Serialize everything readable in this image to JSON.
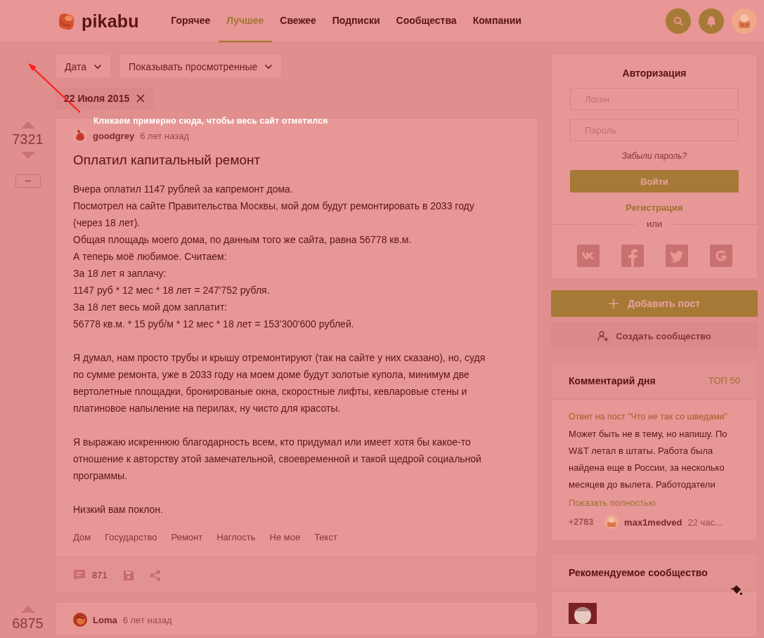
{
  "header": {
    "logo": "pikabu",
    "nav": [
      {
        "label": "Горячее",
        "selected": false
      },
      {
        "label": "Лучшее",
        "selected": true
      },
      {
        "label": "Свежее",
        "selected": false
      },
      {
        "label": "Подписки",
        "selected": false
      },
      {
        "label": "Сообщества",
        "selected": false
      },
      {
        "label": "Компании",
        "selected": false
      }
    ]
  },
  "filters": [
    {
      "label": "Дата"
    },
    {
      "label": "Показывать просмотренные"
    }
  ],
  "date_chip": "22 Июля 2015",
  "annotation": "Кликаем примерно сюда, чтобы весь сайт отметился",
  "posts": [
    {
      "rating": "7321",
      "author": "goodgrey",
      "time": "6 лет назад",
      "title": "Оплатил капитальный ремонт",
      "blocks": [
        [
          "Вчера оплатил 1147 рублей за капремонт дома.",
          "Посмотрел на сайте Правительства Москвы, мой дом будут ремонтировать в 2033 году (через 18 лет).",
          "Общая площадь моего дома, по данным того же сайта, равна 56778 кв.м.",
          "А теперь моё любимое. Считаем:",
          "За 18 лет я заплачу:",
          "1147 руб * 12 мес * 18 лет = 247'752 рубля.",
          "За 18 лет весь мой дом заплатит:",
          "56778 кв.м. * 15 руб/м * 12 мес * 18 лет = 153'300'600 рублей."
        ],
        [
          "Я думал, нам просто трубы и крышу отремонтируют (так на сайте у них сказано), но, судя по сумме ремонта, уже в 2033 году на моем доме будут золотые купола, минимум две вертолетные площадки, бронированые окна, скоростные лифты, кевларовые стены и платиновое напыление на перилах, ну чисто для красоты."
        ],
        [
          "Я выражаю искреннюю благодарность всем, кто придумал или имеет хотя бы какое-то отношение к авторству этой замечательной, своевременной и такой щедрой социальной программы."
        ],
        [
          "Низкий вам поклон."
        ]
      ],
      "tags": [
        "Дом",
        "Государство",
        "Ремонт",
        "Наглость",
        "Не мое",
        "Текст"
      ],
      "comments": "871"
    },
    {
      "rating": "6875",
      "author": "Loma",
      "time": "6 лет назад"
    }
  ],
  "auth": {
    "title": "Авторизация",
    "login_placeholder": "Логин",
    "password_placeholder": "Пароль",
    "forgot": "Забыли пароль?",
    "submit": "Войти",
    "register": "Регистрация",
    "or": "или"
  },
  "add_post": "Добавить пост",
  "create_community": "Создать сообщество",
  "comment_of_day": {
    "title": "Комментарий дня",
    "top": "ТОП 50",
    "post_link": "Ответ на пост \"Что не так со шведами\"",
    "text": "Может быть не в тему, но напишу. По W&T летал в штаты. Работа была найдена еще в России, за несколько месяцев до вылета. Работодатели",
    "more": "Показать полностью",
    "rating": "+2783",
    "author": "max1medved",
    "time": "22 час..."
  },
  "recommended": {
    "title": "Рекомендуемое сообщество"
  }
}
